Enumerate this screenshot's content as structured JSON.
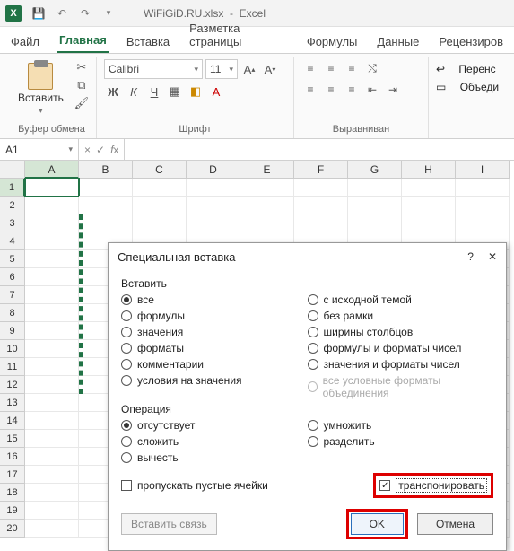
{
  "titlebar": {
    "filename": "WiFiGiD.RU.xlsx",
    "app": "Excel"
  },
  "tabs": [
    "Файл",
    "Главная",
    "Вставка",
    "Разметка страницы",
    "Формулы",
    "Данные",
    "Рецензиров"
  ],
  "active_tab": 1,
  "ribbon": {
    "clipboard": {
      "paste": "Вставить",
      "group": "Буфер обмена"
    },
    "font": {
      "name": "Calibri",
      "size": "11",
      "group": "Шрифт"
    },
    "align": {
      "wrap": "Перенс",
      "merge": "Объеди",
      "group": "Выравниван"
    }
  },
  "namebox": "A1",
  "columns": [
    "A",
    "B",
    "C",
    "D",
    "E",
    "F",
    "G",
    "H",
    "I"
  ],
  "rows": [
    1,
    2,
    3,
    4,
    5,
    6,
    7,
    8,
    9,
    10,
    11,
    12,
    13,
    14,
    15,
    16,
    17,
    18,
    19,
    20
  ],
  "dialog": {
    "title": "Специальная вставка",
    "help": "?",
    "paste_label": "Вставить",
    "paste_left": [
      "все",
      "формулы",
      "значения",
      "форматы",
      "комментарии",
      "условия на значения"
    ],
    "paste_right": [
      "с исходной темой",
      "без рамки",
      "ширины столбцов",
      "формулы и форматы чисел",
      "значения и форматы чисел",
      "все условные форматы объединения"
    ],
    "paste_selected": 0,
    "paste_disabled": [
      11
    ],
    "op_label": "Операция",
    "op_left": [
      "отсутствует",
      "сложить",
      "вычесть"
    ],
    "op_right": [
      "умножить",
      "разделить"
    ],
    "op_selected": 0,
    "skip_blanks": "пропускать пустые ячейки",
    "transpose": "транспонировать",
    "link": "Вставить связь",
    "ok": "OK",
    "cancel": "Отмена"
  }
}
